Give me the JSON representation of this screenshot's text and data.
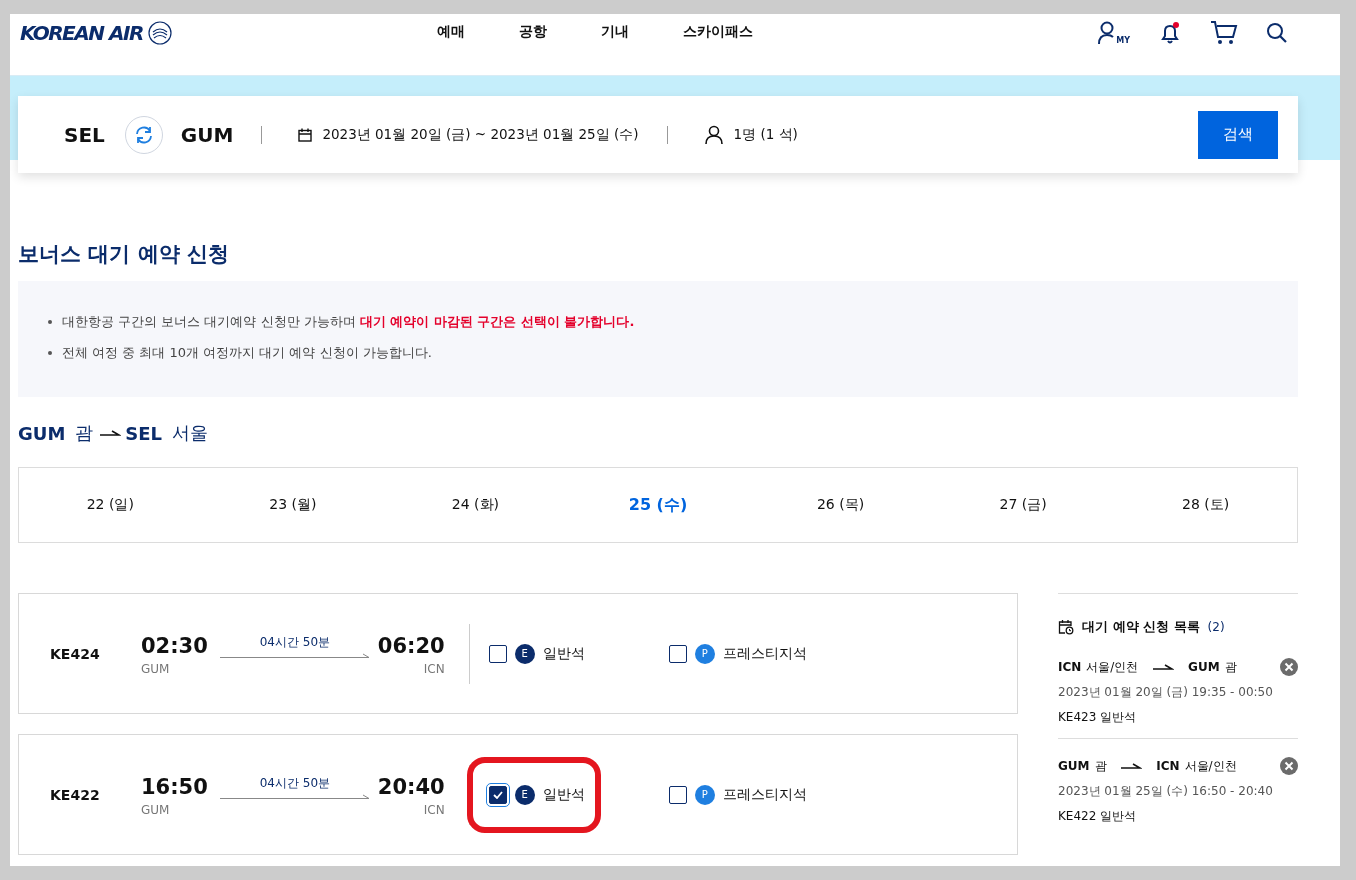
{
  "header": {
    "logo": "KOREAN AIR",
    "nav": [
      {
        "label": "예매"
      },
      {
        "label": "공항"
      },
      {
        "label": "기내"
      },
      {
        "label": "스카이패스"
      }
    ],
    "my_label": "MY"
  },
  "search": {
    "origin": "SEL",
    "destination": "GUM",
    "dates": "2023년 01월 20일 (금) ~ 2023년 01월 25일 (수)",
    "passengers": "1명 (1 석)",
    "button": "검색"
  },
  "title": "보너스 대기 예약 신청",
  "notices": [
    "대한항공 구간의 보너스 대기예약 신청만 가능하며 **대기 예약이 마감된 구간은 선택이 불가합니다.**",
    "전체 여정 중 최대 10개 여정까지 대기 예약 신청이 가능합니다."
  ],
  "route": {
    "from_code": "GUM",
    "from_city": "괌",
    "to_code": "SEL",
    "to_city": "서울"
  },
  "dates": [
    {
      "label": "22 (일)",
      "selected": false
    },
    {
      "label": "23 (월)",
      "selected": false
    },
    {
      "label": "24 (화)",
      "selected": false
    },
    {
      "label": "25 (수)",
      "selected": true
    },
    {
      "label": "26 (목)",
      "selected": false
    },
    {
      "label": "27 (금)",
      "selected": false
    },
    {
      "label": "28 (토)",
      "selected": false
    }
  ],
  "flights": [
    {
      "number": "KE424",
      "departure": "02:30",
      "from": "GUM",
      "duration": "04시간 50분",
      "arrival": "06:20",
      "to": "ICN",
      "fares": [
        {
          "badge": "E",
          "label": "일반석",
          "checked": false,
          "highlighted": false,
          "color": "#0b2c6b"
        },
        {
          "badge": "P",
          "label": "프레스티지석",
          "checked": false,
          "highlighted": false,
          "color": "#1f7fe0"
        }
      ]
    },
    {
      "number": "KE422",
      "departure": "16:50",
      "from": "GUM",
      "duration": "04시간 50분",
      "arrival": "20:40",
      "to": "ICN",
      "fares": [
        {
          "badge": "E",
          "label": "일반석",
          "checked": true,
          "highlighted": true,
          "color": "#0b2c6b"
        },
        {
          "badge": "P",
          "label": "프레스티지석",
          "checked": false,
          "highlighted": false,
          "color": "#1f7fe0"
        }
      ]
    }
  ],
  "waitlist": {
    "title": "대기 예약 신청 목록",
    "count": "(2)",
    "items": [
      {
        "from_code": "ICN",
        "from_city": "서울/인천",
        "to_code": "GUM",
        "to_city": "괌",
        "schedule": "2023년 01월 20일 (금) 19:35 - 00:50",
        "flight": "KE423",
        "cabin": "일반석"
      },
      {
        "from_code": "GUM",
        "from_city": "괌",
        "to_code": "ICN",
        "to_city": "서울/인천",
        "schedule": "2023년 01월 25일 (수) 16:50 - 20:40",
        "flight": "KE422",
        "cabin": "일반석"
      }
    ]
  }
}
